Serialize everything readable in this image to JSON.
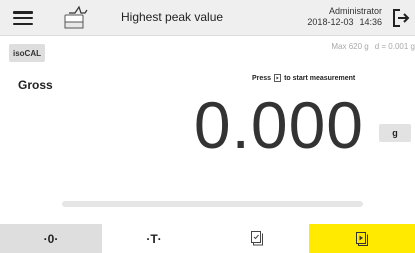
{
  "header": {
    "menu_icon": "hamburger-menu-icon",
    "method_icon": "peak-weighing-icon",
    "title": "Highest peak value",
    "user": "Administrator",
    "date": "2018-12-03",
    "time": "14:36",
    "logout_icon": "logout-icon"
  },
  "toolbar": {
    "isocal_label": "isoCAL",
    "max_capacity": "Max 620 g",
    "readability": "d = 0.001 g"
  },
  "display": {
    "mode_label": "Gross",
    "instruction_pre": "Press",
    "instruction_icon": "start-measurement-icon",
    "instruction_post": "to start measurement",
    "weight": "0.000",
    "unit": "g",
    "capacity_bar_fraction": 0.0
  },
  "footer": {
    "zero_label": "·0·",
    "tare_label": "·T·",
    "result_icon": "result-document-icon",
    "start_icon": "start-measurement-icon"
  },
  "colors": {
    "header_bg": "#efefef",
    "button_gray": "#dedede",
    "accent_yellow": "#ffea00"
  }
}
